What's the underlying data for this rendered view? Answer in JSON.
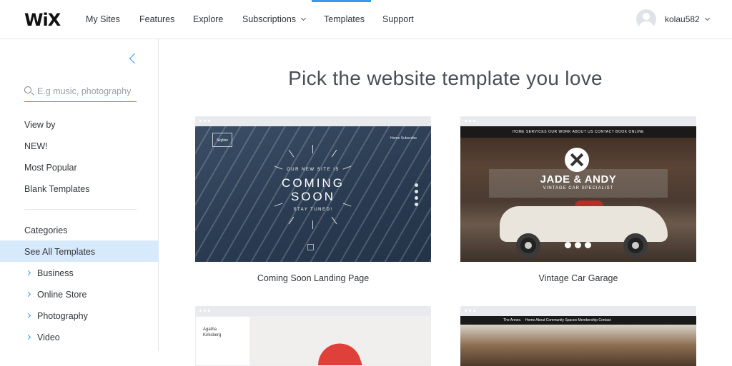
{
  "header": {
    "logo": "WiX",
    "nav": [
      "My Sites",
      "Features",
      "Explore",
      "Subscriptions",
      "Templates",
      "Support"
    ],
    "active": "Templates",
    "username": "kolau582"
  },
  "sidebar": {
    "search_placeholder": "E.g music, photography",
    "view_by": "View by",
    "view_items": [
      "NEW!",
      "Most Popular",
      "Blank Templates"
    ],
    "categories_title": "Categories",
    "selected": "See All Templates",
    "categories": [
      "Business",
      "Online Store",
      "Photography",
      "Video"
    ]
  },
  "main": {
    "headline": "Pick the website template you love",
    "cards": [
      {
        "caption": "Coming Soon Landing Page",
        "thumb": {
          "brand": "Skyline",
          "nav": "Home  Subscribe",
          "kicker": "OUR NEW SITE IS",
          "line1": "COMING",
          "line2": "SOON",
          "footer": "STAY TUNED!"
        }
      },
      {
        "caption": "Vintage Car Garage",
        "thumb": {
          "nav": "HOME   SERVICES   OUR WORK   ABOUT US   CONTACT   BOOK ONLINE",
          "title": "JADE & ANDY",
          "subtitle": "VINTAGE CAR SPECIALIST"
        }
      },
      {
        "caption": "",
        "thumb": {
          "name_line1": "Agatha",
          "name_line2": "Kirksberg"
        }
      },
      {
        "caption": "",
        "thumb": {
          "brand": "The Annex.",
          "nav": "Home   About   Community   Spaces   Membership   Contact"
        }
      }
    ]
  }
}
